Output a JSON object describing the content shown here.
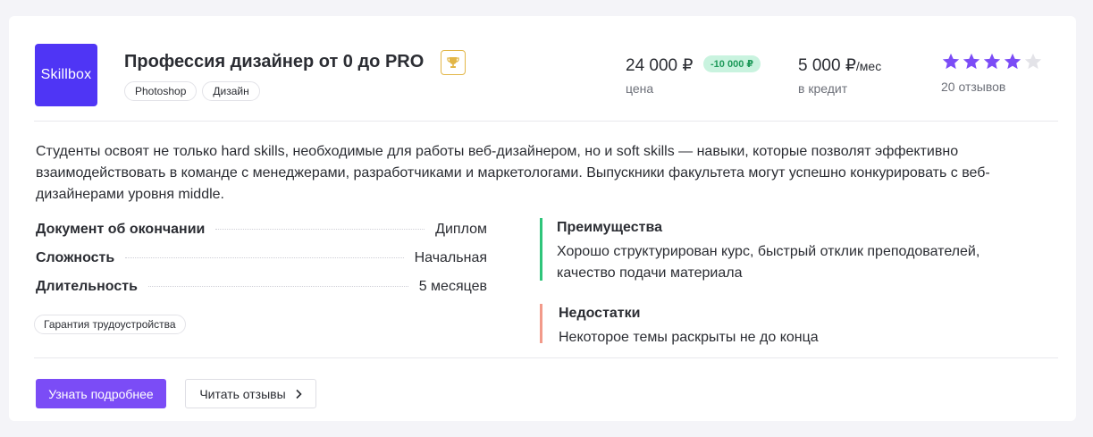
{
  "course": {
    "logo_text": "Skillbox",
    "title": "Профессия дизайнер от 0 до PRO",
    "tags": [
      "Photoshop",
      "Дизайн"
    ],
    "price": "24 000 ₽",
    "discount": "-10 000 ₽",
    "price_label": "цена",
    "credit": "5 000 ₽",
    "credit_unit": "/мес",
    "credit_label": "в кредит",
    "rating": 4,
    "rating_max": 5,
    "reviews": "20 отзывов",
    "description": "Студенты освоят не только hard skills, необходимые для работы веб-дизайнером, но и soft skills — навыки, которые позволят эффективно взаимодействовать в команде с менеджерами, разработчиками и маркетологами. Выпускники факультета могут успешно конкурировать с веб-дизайнерами уровня middle."
  },
  "specs": [
    {
      "label": "Документ об окончании",
      "value": "Диплом"
    },
    {
      "label": "Сложность",
      "value": "Начальная"
    },
    {
      "label": "Длительность",
      "value": "5 месяцев"
    }
  ],
  "guarantee": "Гарантия трудоустройства",
  "pros": {
    "title": "Преимущества",
    "text": "Хорошо структурирован курс, быстрый отклик преподователей, качество подачи материала"
  },
  "cons": {
    "title": "Недостатки",
    "text": "Некоторое темы раскрыты не до конца"
  },
  "actions": {
    "more": "Узнать подробнее",
    "reviews": "Читать отзывы"
  },
  "colors": {
    "brand": "#4f35f5",
    "accent": "#7b4cf6",
    "star_on": "#7b4cf6",
    "star_off": "#e3e3e8",
    "pros": "#2fc57a",
    "cons": "#f29a8a"
  }
}
